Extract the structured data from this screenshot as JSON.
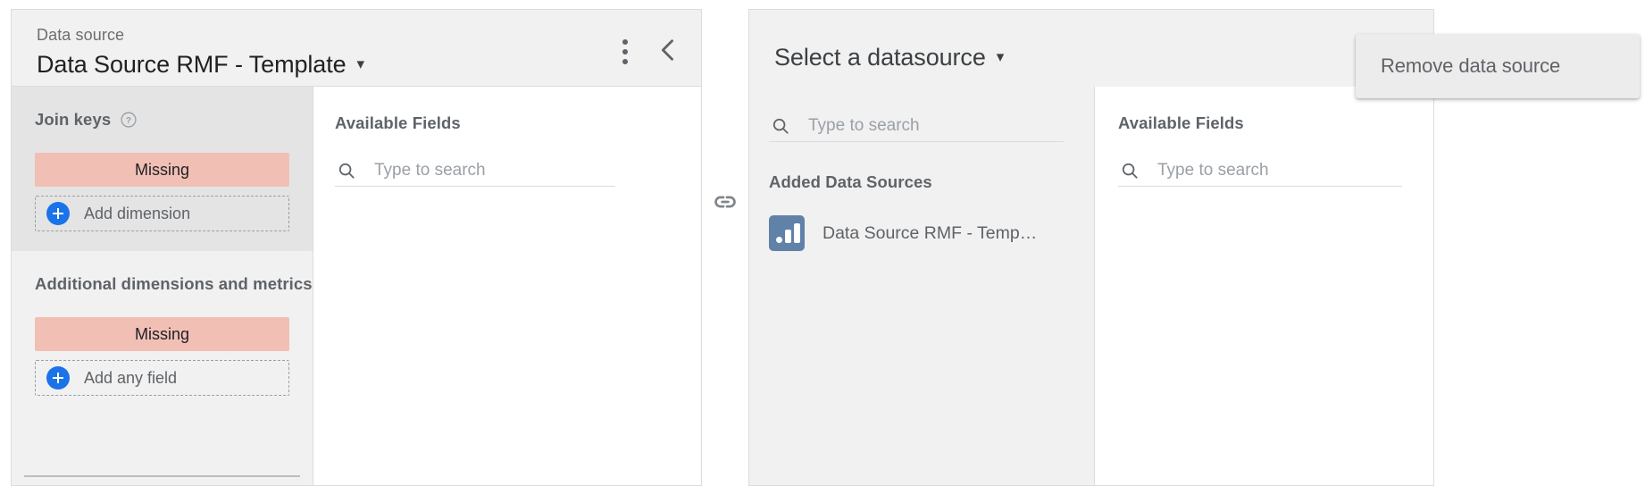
{
  "left_card": {
    "header": {
      "label": "Data source",
      "title": "Data Source RMF - Template",
      "caret": "▾",
      "kebab_icon": "more-vert-icon",
      "collapse_icon": "chevron-left-icon"
    },
    "join_panel": {
      "sections": [
        {
          "title": "Join keys",
          "help_icon": "help-circle-icon",
          "missing_label": "Missing",
          "add_label": "Add dimension"
        },
        {
          "title": "Additional dimensions and metrics",
          "missing_label": "Missing",
          "add_label": "Add any field"
        }
      ]
    },
    "fields_panel": {
      "title": "Available Fields",
      "search_icon": "search-icon",
      "search_placeholder": "Type to search",
      "search_value": ""
    }
  },
  "join_link": {
    "icon": "link-icon"
  },
  "right_card": {
    "header": {
      "title": "Select a datasource",
      "caret": "▾"
    },
    "added_panel": {
      "search_icon": "search-icon",
      "search_placeholder": "Type to search",
      "search_value": "",
      "title": "Added Data Sources",
      "items": [
        {
          "icon": "data-source-chart-icon",
          "label": "Data Source RMF - Temp…"
        }
      ]
    },
    "fields_panel": {
      "title": "Available Fields",
      "search_icon": "search-icon",
      "search_placeholder": "Type to search",
      "search_value": ""
    }
  },
  "remove_menu": {
    "label": "Remove data source"
  },
  "colors": {
    "missing_chip": "#F2BFB5",
    "add_badge": "#1A73E8",
    "data_source_icon": "#6081A8",
    "panel_gray": "#F1F1F1",
    "panel_gray_shaded": "#E4E4E4",
    "menu_bg": "#ECECEC",
    "text_primary": "#202124",
    "text_secondary": "#5F6368"
  }
}
